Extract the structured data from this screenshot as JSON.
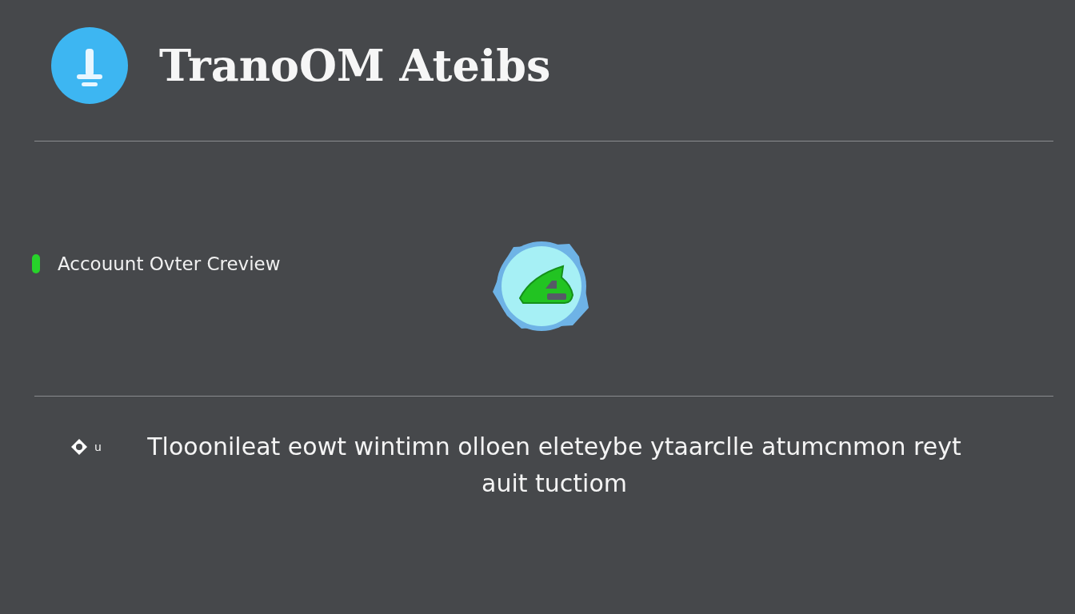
{
  "header": {
    "title": "TranoOM Ateibs"
  },
  "section": {
    "label": "Accouunt Ovter Creview",
    "status_on": true
  },
  "footer": {
    "marker": "u",
    "text": "Tlooonileat eowt wintimn olloen eleteybe ytaarclle atumcnmon reyt auit tuctiom"
  }
}
